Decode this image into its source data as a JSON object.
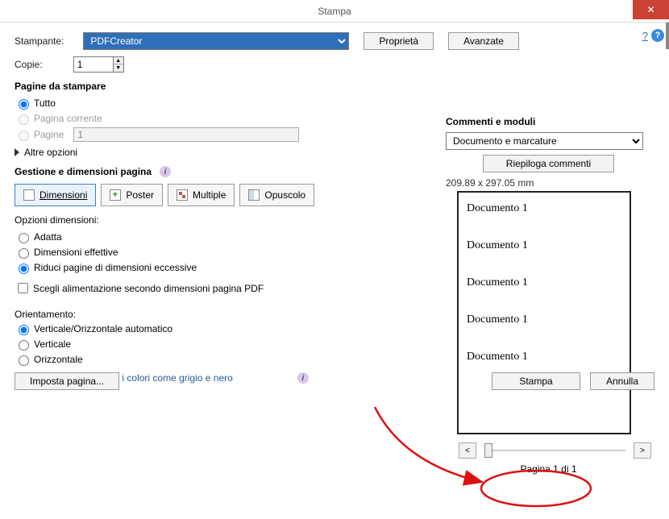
{
  "window": {
    "title": "Stampa",
    "close": "✕"
  },
  "top": {
    "printer_label": "Stampante:",
    "printer_value": "PDFCreator",
    "properties_btn": "Proprietà",
    "advanced_btn": "Avanzate",
    "copies_label": "Copie:",
    "copies_value": "1"
  },
  "help": {
    "q": "?",
    "i": "?"
  },
  "pages_section": {
    "title": "Pagine da stampare",
    "all": "Tutto",
    "current": "Pagina corrente",
    "pages_lbl": "Pagine",
    "pages_val": "1",
    "more": "Altre opzioni"
  },
  "handling": {
    "title": "Gestione e dimensioni pagina",
    "tabs": {
      "size": "Dimensioni",
      "poster": "Poster",
      "multiple": "Multiple",
      "booklet": "Opuscolo"
    },
    "size_opts_title": "Opzioni dimensioni:",
    "fit": "Adatta",
    "actual": "Dimensioni effettive",
    "shrink": "Riduci pagine di dimensioni eccessive",
    "choose_paper": "Scegli alimentazione secondo dimensioni pagina PDF"
  },
  "orientation": {
    "title": "Orientamento:",
    "auto": "Verticale/Orizzontale automatico",
    "portrait": "Verticale",
    "landscape": "Orizzontale"
  },
  "grayscale_link": "Come fare per stampare i colori come grigio e nero",
  "comments": {
    "title": "Commenti e moduli",
    "value": "Documento e marcature",
    "summarize_btn": "Riepiloga commenti"
  },
  "preview": {
    "dims": "209.89 x 297.05 mm",
    "lines": [
      "Documento 1",
      "Documento 1",
      "Documento 1",
      "Documento 1",
      "Documento 1"
    ],
    "nav_prev": "<",
    "nav_next": ">",
    "page_of": "Pagina 1 di 1"
  },
  "footer": {
    "page_setup": "Imposta pagina...",
    "print": "Stampa",
    "cancel": "Annulla"
  }
}
